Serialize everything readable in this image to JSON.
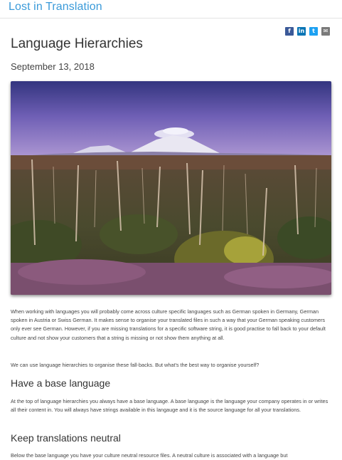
{
  "site": {
    "title": "Lost in Translation"
  },
  "share": {
    "facebook_glyph": "f",
    "linkedin_glyph": "in",
    "twitter_glyph": "t",
    "email_glyph": "✉"
  },
  "post": {
    "title": "Language Hierarchies",
    "date": "September 13, 2018",
    "paragraphs": [
      "When working with languages you will probably come across culture specific languages such as German spoken in Germany, German spoken in Austria or Swiss German. It makes sense to organise your translated files in such a way that your German speaking customers only ever see German. However, if you are missing translations for a specific software string, it is good practise to fall back to your default culture and not show your customers that a string is missing or not show them anything at all.",
      "We can use language hierarchies to organise these fall-backs. But what's the best way to organise yourself?",
      "At the top of language hierarchies you always have a base language. A base language is the language your company operates in or writes all their content in. You will always have strings available in this langauge and it is the source language for all your translations.",
      "Below the base language you have your culture neutral resource files. A neutral culture is associated with a language but"
    ],
    "headings": {
      "base": "Have a base language",
      "neutral": "Keep translations neutral"
    }
  }
}
